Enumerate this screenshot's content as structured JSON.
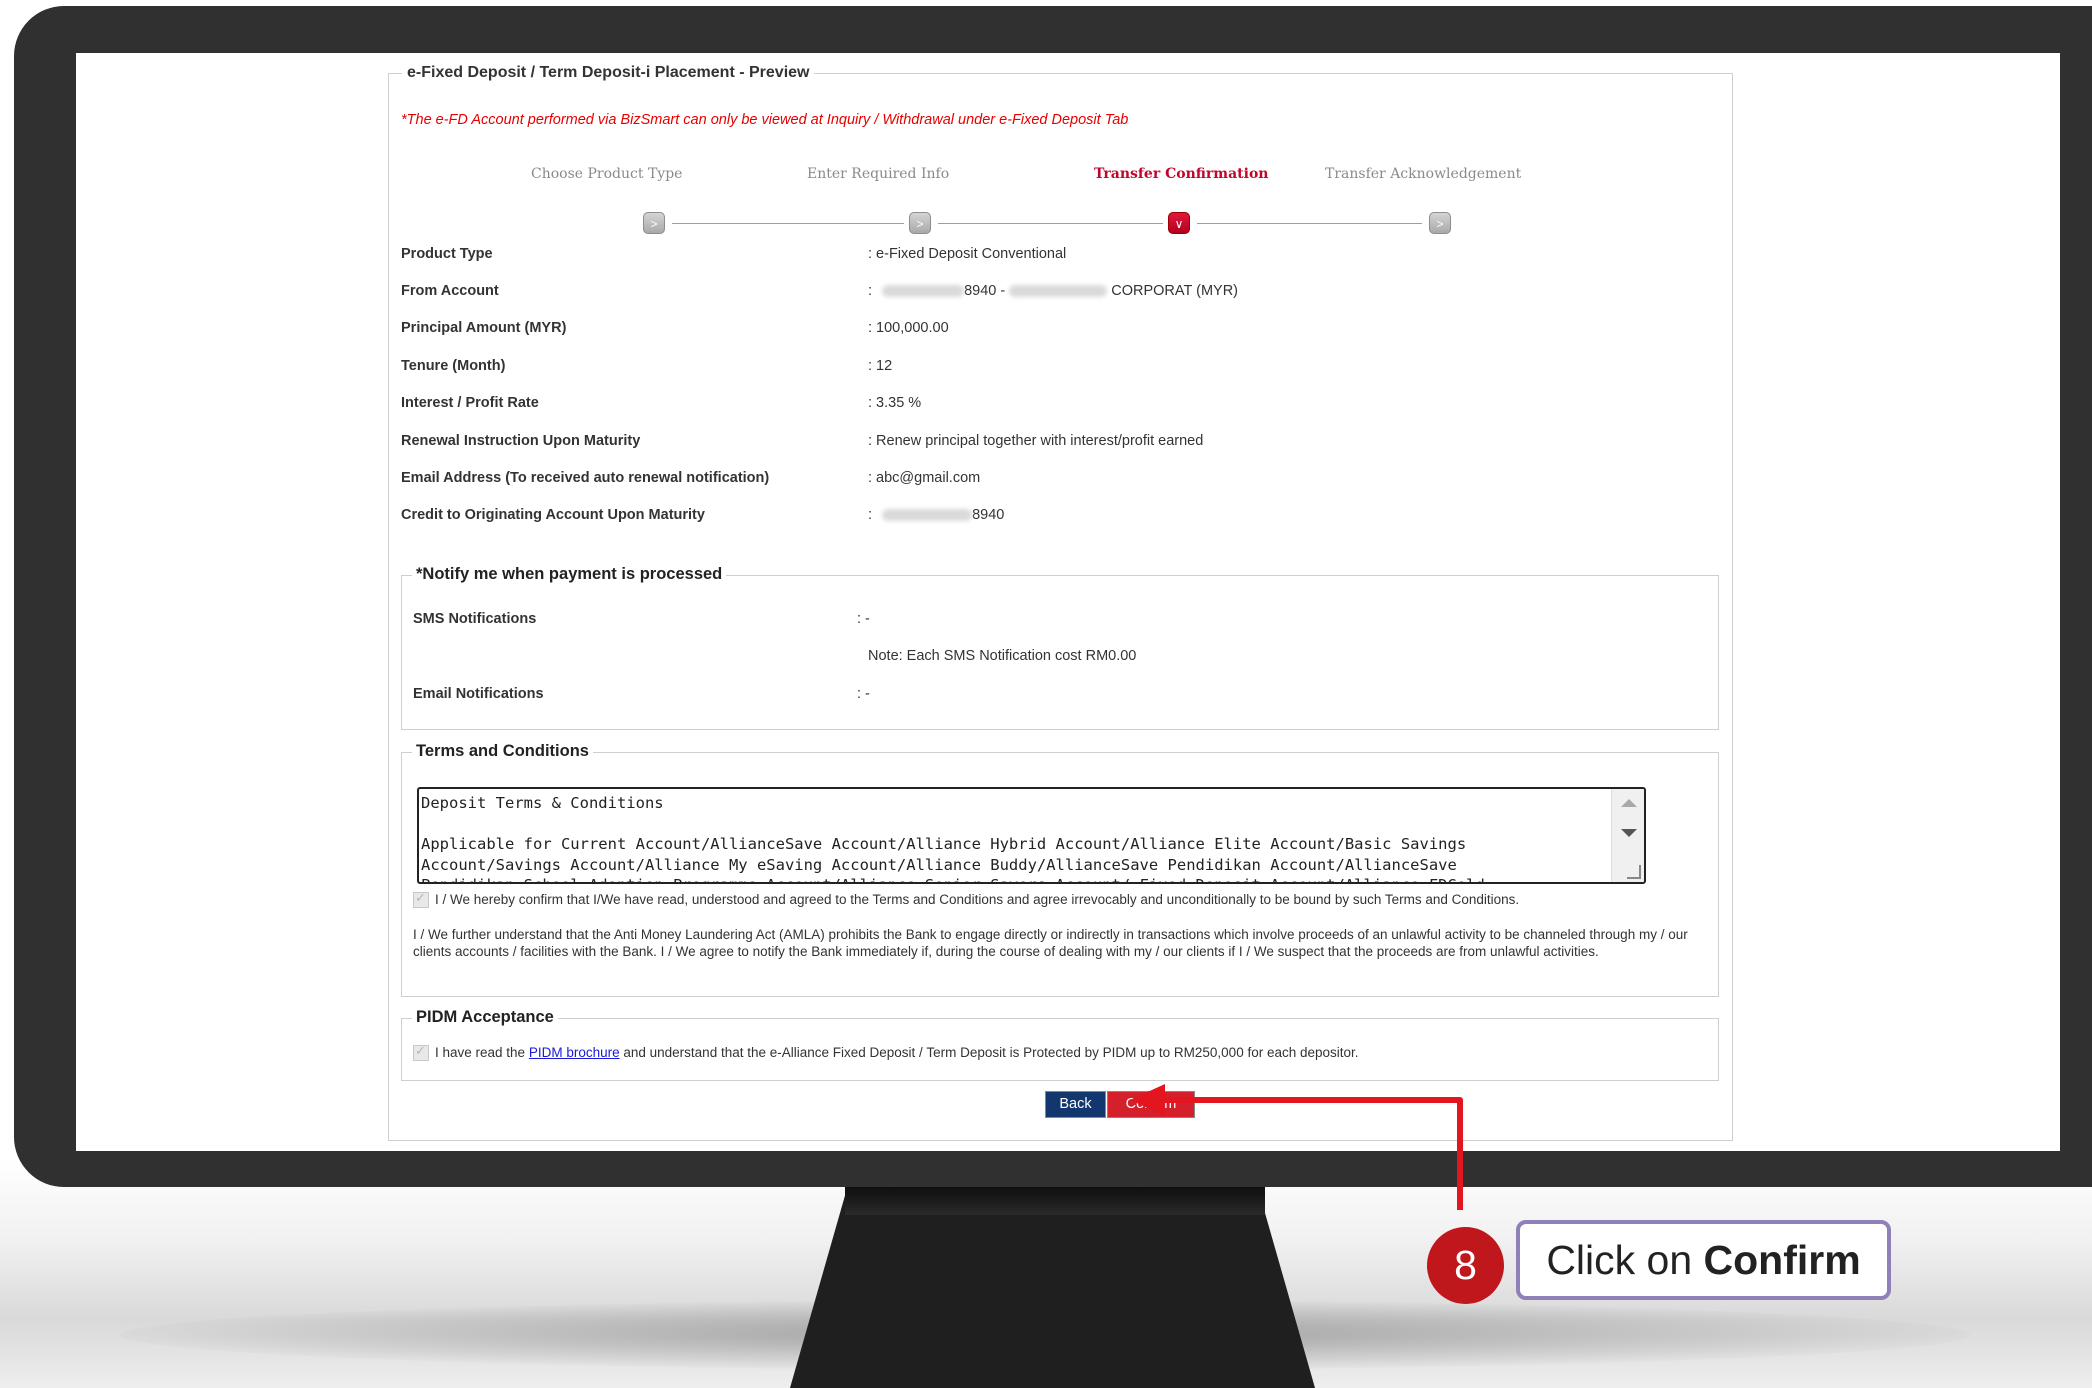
{
  "form": {
    "legend": "e-Fixed Deposit / Term Deposit-i Placement - Preview",
    "notice": "*The e-FD Account performed via BizSmart can only be viewed at Inquiry / Withdrawal under e-Fixed Deposit Tab",
    "steps": [
      {
        "label": "Choose Product Type",
        "active": false
      },
      {
        "label": "Enter Required Info",
        "active": false
      },
      {
        "label": "Transfer Confirmation",
        "active": true
      },
      {
        "label": "Transfer Acknowledgement",
        "active": false
      }
    ],
    "rows": [
      {
        "label": "Product Type",
        "value": ":  e-Fixed Deposit Conventional"
      },
      {
        "label": "From Account",
        "sep": ":",
        "acct_suffix": "8940 -",
        "name_suffix": "CORPORAT (MYR)"
      },
      {
        "label": "Principal Amount (MYR)",
        "value": ": 100,000.00"
      },
      {
        "label": "Tenure (Month)",
        "value": ": 12"
      },
      {
        "label": "Interest / Profit Rate",
        "value": ": 3.35 %"
      },
      {
        "label": "Renewal Instruction Upon Maturity",
        "value": ": Renew principal together with interest/profit earned"
      },
      {
        "label": "Email Address (To received auto renewal notification)",
        "value": ": abc@gmail.com"
      },
      {
        "label": "Credit to Originating Account Upon Maturity",
        "sep": ":",
        "acct_suffix": "8940"
      }
    ],
    "notify": {
      "legend": "*Notify me when payment is processed",
      "sms_label": "SMS Notifications",
      "sms_value": ": -",
      "sms_note": "Note: Each SMS Notification cost RM0.00",
      "email_label": "Email Notifications",
      "email_value": ": -"
    },
    "terms": {
      "legend": "Terms and Conditions",
      "textarea": "Deposit Terms & Conditions\n\nApplicable for Current Account/AllianceSave Account/Alliance Hybrid Account/Alliance Elite Account/Basic Savings\nAccount/Savings Account/Alliance My eSaving Account/Alliance Buddy/AllianceSave Pendidikan Account/AllianceSave\nPendidikan School Adoption Programme Account/Alliance Senior Savers Account/ Fixed Deposit Account/Alliance FDGold",
      "confirm_text": "I / We hereby confirm that I/We have read, understood and agreed to the Terms and Conditions and agree irrevocably and unconditionally to be bound by such Terms and Conditions.",
      "amla_text": "I / We further understand that the Anti Money Laundering Act (AMLA) prohibits the Bank to engage directly or indirectly in transactions which involve proceeds of an unlawful activity to be channeled through my / our clients accounts / facilities with the Bank. I / We agree to notify the Bank immediately if, during the course of dealing with my / our clients if I / We suspect that the proceeds are from unlawful activities."
    },
    "pidm": {
      "legend": "PIDM Acceptance",
      "text_before": "I have read the ",
      "link": "PIDM brochure",
      "text_after": " and understand that the e-Alliance Fixed Deposit / Term Deposit is Protected by PIDM up to RM250,000 for each depositor."
    },
    "buttons": {
      "back": "Back",
      "confirm": "Confirm"
    }
  },
  "callout": {
    "step": "8",
    "prefix": "Click on ",
    "bold": "Confirm"
  },
  "colors": {
    "accent_red": "#d3202a",
    "back_blue": "#12366e",
    "notice_red": "#e60000",
    "callout_border": "#9080b8",
    "badge_red": "#c0171c"
  }
}
